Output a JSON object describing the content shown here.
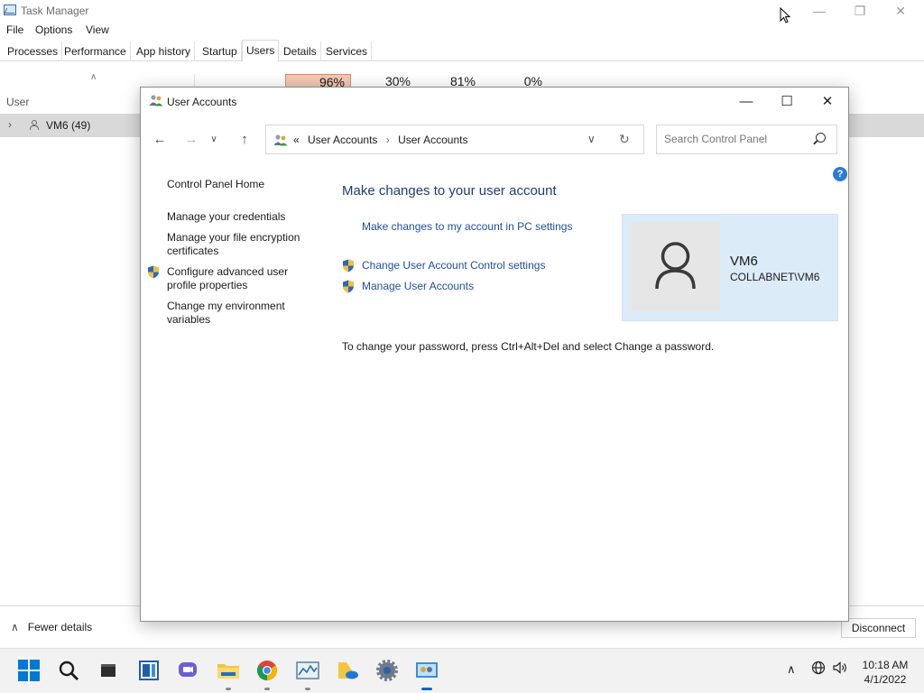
{
  "task_manager": {
    "title": "Task Manager",
    "menu": [
      "File",
      "Options",
      "View"
    ],
    "tabs": [
      "Processes",
      "Performance",
      "App history",
      "Startup",
      "Users",
      "Details",
      "Services"
    ],
    "active_tab": "Users",
    "percentages": [
      "96%",
      "30%",
      "81%",
      "0%"
    ],
    "column_header": "User",
    "user_row": "VM6 (49)",
    "fewer_details": "Fewer details",
    "disconnect": "Disconnect"
  },
  "user_accounts": {
    "title": "User Accounts",
    "breadcrumb": [
      "User Accounts",
      "User Accounts"
    ],
    "breadcrumb_prefix": "«",
    "search_placeholder": "Search Control Panel",
    "help": "?",
    "left_nav": {
      "home": "Control Panel Home",
      "credentials": "Manage your credentials",
      "encryption": "Manage your file encryption certificates",
      "profile": "Configure advanced user profile properties",
      "environment": "Change my environment variables"
    },
    "heading": "Make changes to your user account",
    "pc_settings_link": "Make changes to my account in PC settings",
    "uac_link": "Change User Account Control settings",
    "manage_link": "Manage User Accounts",
    "account_name": "VM6",
    "account_domain": "COLLABNET\\VM6",
    "password_note": "To change your password, press Ctrl+Alt+Del and select Change a password."
  },
  "taskbar": {
    "apps": [
      "start-icon",
      "search-icon",
      "terminal-icon",
      "task-view-icon",
      "chat-icon",
      "file-explorer-icon",
      "chrome-icon",
      "task-manager-icon",
      "onedrive-folder-icon",
      "settings-icon",
      "control-panel-icon"
    ],
    "time": "10:18 AM",
    "date": "4/1/2022"
  },
  "colors": {
    "link": "#1f4e99",
    "heading": "#1e3d73",
    "account_tile": "#dcebf8",
    "accent": "#0067c0"
  }
}
